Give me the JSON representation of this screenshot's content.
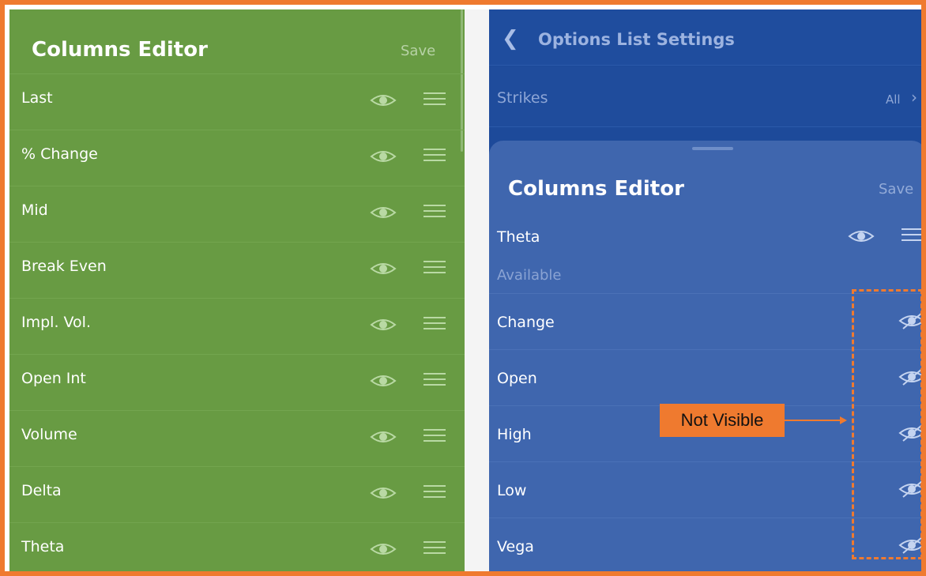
{
  "left_panel": {
    "title": "Columns Editor",
    "save_label": "Save",
    "rows": [
      {
        "label": "Last"
      },
      {
        "label": "% Change"
      },
      {
        "label": "Mid"
      },
      {
        "label": "Break Even"
      },
      {
        "label": "Impl. Vol."
      },
      {
        "label": "Open Int"
      },
      {
        "label": "Volume"
      },
      {
        "label": "Delta"
      },
      {
        "label": "Theta"
      }
    ]
  },
  "right_panel": {
    "header": {
      "back_icon": "chevron-left-icon",
      "title": "Options List Settings"
    },
    "strikes": {
      "label": "Strikes",
      "value": "All"
    },
    "sheet": {
      "title": "Columns Editor",
      "save_label": "Save",
      "visible_rows": [
        {
          "label": "Theta"
        }
      ],
      "available_label": "Available",
      "available_rows": [
        {
          "label": "Change"
        },
        {
          "label": "Open"
        },
        {
          "label": "High"
        },
        {
          "label": "Low"
        },
        {
          "label": "Vega"
        }
      ]
    }
  },
  "annotation": {
    "callout_text": "Not Visible"
  },
  "colors": {
    "frame": "#ef7a2f",
    "left_bg": "#689b43",
    "right_header_bg": "#1f4d9e",
    "sheet_bg": "#3f66ae",
    "icon_green": "#b9d9a4",
    "icon_blue": "#c5d4f0"
  }
}
